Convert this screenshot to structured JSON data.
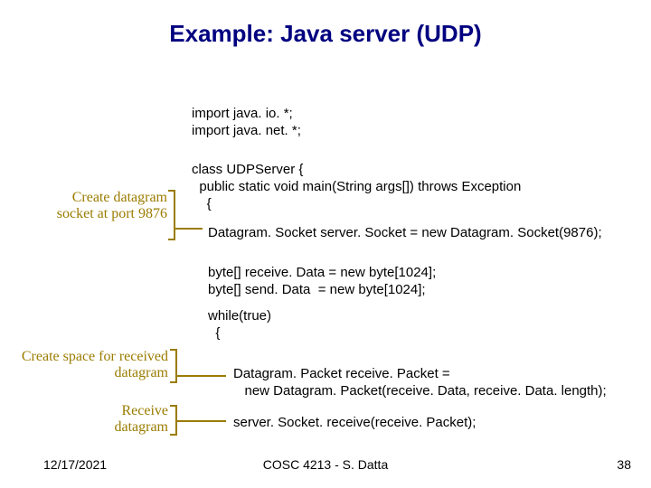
{
  "title": "Example: Java server (UDP)",
  "code": {
    "imports": "import java. io. *;\nimport java. net. *;",
    "classdecl": "class UDPServer {\n  public static void main(String args[]) throws Exception\n    {",
    "dsline": "Datagram. Socket server. Socket = new Datagram. Socket(9876);",
    "bytelines": "byte[] receive. Data = new byte[1024];\nbyte[] send. Data  = new byte[1024];",
    "whileblk": "while(true)\n  {",
    "pktlines": "Datagram. Packet receive. Packet =\n   new Datagram. Packet(receive. Data, receive. Data. length);",
    "recvline": "server. Socket. receive(receive. Packet);"
  },
  "annotations": {
    "a1": "Create\ndatagram socket\nat port 9876",
    "a2": "Create space for\nreceived datagram",
    "a3": "Receive\ndatagram"
  },
  "footer": {
    "date": "12/17/2021",
    "center": "COSC 4213 - S. Datta",
    "page": "38"
  }
}
